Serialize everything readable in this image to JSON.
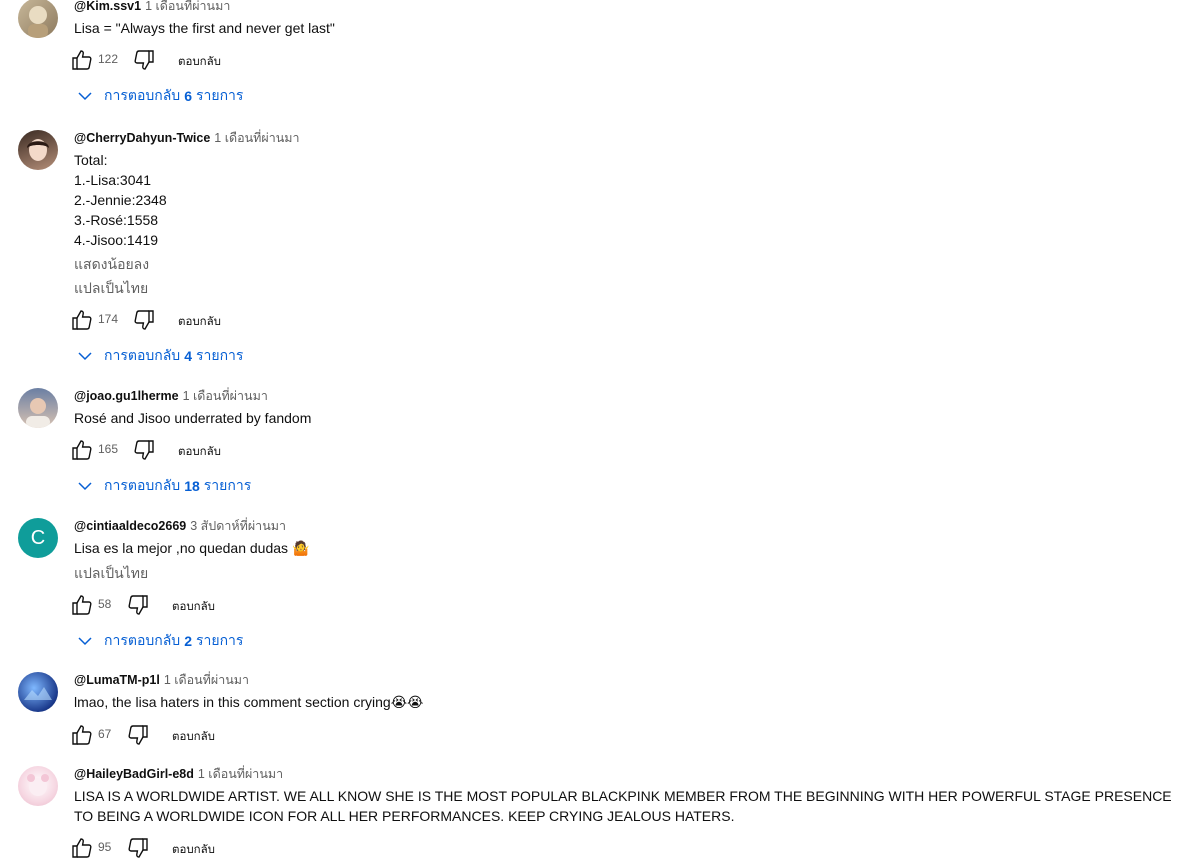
{
  "labels": {
    "reply": "ตอบกลับ",
    "replies_prefix": "การตอบกลับ",
    "replies_suffix": "รายการ",
    "show_less": "แสดงน้อยลง",
    "translate": "แปลเป็นไทย"
  },
  "comments": [
    {
      "author": "@Kim.ssv1",
      "time": "1 เดือนที่ผ่านมา",
      "lines": [
        "Lisa = \"Always the first and never get last\""
      ],
      "likes": "122",
      "replies_count": "6"
    },
    {
      "author": "@CherryDahyun-Twice",
      "time": "1 เดือนที่ผ่านมา",
      "lines": [
        "Total:",
        "1.-Lisa:3041",
        "2.-Jennie:2348",
        "3.-Rosé:1558",
        "4.-Jisoo:1419"
      ],
      "likes": "174",
      "replies_count": "4"
    },
    {
      "author": "@joao.gu1lherme",
      "time": "1 เดือนที่ผ่านมา",
      "lines": [
        "Rosé and Jisoo underrated by fandom"
      ],
      "likes": "165",
      "replies_count": "18"
    },
    {
      "author": "@cintiaaldeco2669",
      "time": "3 สัปดาห์ที่ผ่านมา",
      "lines": [
        "Lisa es la mejor ,no quedan dudas"
      ],
      "emoji": "🤷",
      "avatar_letter": "C",
      "likes": "58",
      "replies_count": "2"
    },
    {
      "author": "@LumaTM-p1l",
      "time": "1 เดือนที่ผ่านมา",
      "lines": [
        "lmao, the lisa haters in this comment section crying"
      ],
      "emoji": "😭😭",
      "likes": "67"
    },
    {
      "author": "@HaileyBadGirl-e8d",
      "time": "1 เดือนที่ผ่านมา",
      "lines": [
        "LISA IS A WORLDWIDE ARTIST. WE ALL KNOW SHE IS THE MOST POPULAR BLACKPINK MEMBER FROM THE BEGINNING WITH HER POWERFUL STAGE PRESENCE TO BEING A WORLDWIDE ICON FOR ALL HER PERFORMANCES. KEEP CRYING JEALOUS HATERS."
      ],
      "likes": "95"
    }
  ],
  "colors": {
    "link_blue": "#065fd4",
    "secondary_text": "#606060",
    "avatar_letter_bg": "#0f9d9a"
  },
  "icons": [
    "like-icon",
    "dislike-icon",
    "chevron-down-icon"
  ]
}
